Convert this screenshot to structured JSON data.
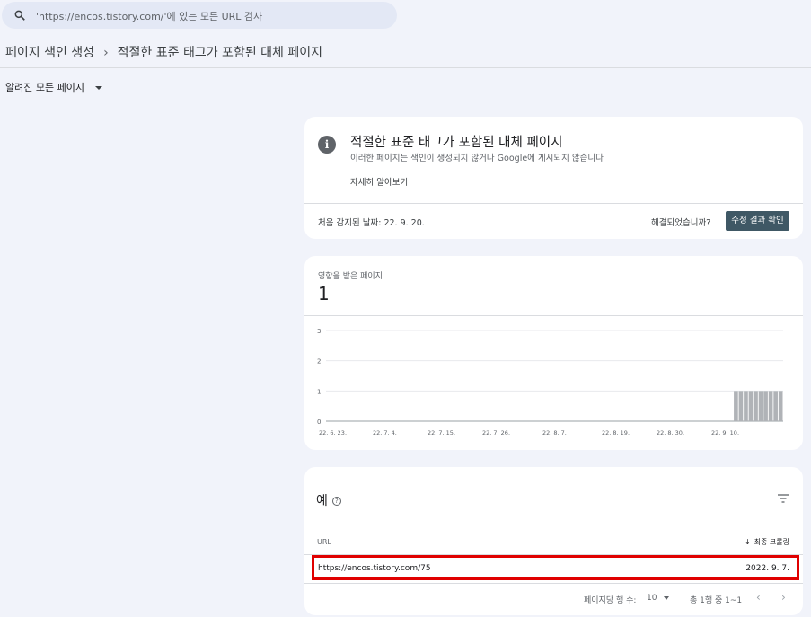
{
  "search": {
    "placeholder": "'https://encos.tistory.com/'에 있는 모든 URL 검사"
  },
  "breadcrumb": {
    "parent": "페이지 색인 생성",
    "current": "적절한 표준 태그가 포함된 대체 페이지"
  },
  "filter": {
    "label": "알려진 모든 페이지"
  },
  "issue": {
    "title": "적절한 표준 태그가 포함된 대체 페이지",
    "description": "이러한 페이지는 색인이 생성되지 않거나 Google에 게시되지 않습니다",
    "learn_more": "자세히 알아보기",
    "first_detected": "처음 감지된 날짜: 22. 9. 20.",
    "resolved_question": "해결되었습니까?",
    "validate_button": "수정 결과 확인"
  },
  "affected": {
    "label": "영향을 받은 페이지",
    "count": "1"
  },
  "chart_data": {
    "type": "bar",
    "ylim": [
      0,
      3
    ],
    "yticks": [
      "0",
      "1",
      "2",
      "3"
    ],
    "xticks": [
      "22. 6. 23.",
      "22. 7. 4.",
      "22. 7. 15.",
      "22. 7. 26.",
      "22. 8. 7.",
      "22. 8. 19.",
      "22. 8. 30.",
      "22. 9. 10."
    ],
    "bar_color": "#b0b3b7",
    "values": [
      0,
      0,
      0,
      0,
      0,
      0,
      0,
      0,
      0,
      0,
      0,
      0,
      0,
      0,
      0,
      0,
      0,
      0,
      0,
      0,
      0,
      0,
      0,
      0,
      0,
      0,
      0,
      0,
      0,
      0,
      0,
      0,
      0,
      0,
      0,
      0,
      0,
      0,
      0,
      0,
      0,
      0,
      0,
      0,
      0,
      0,
      0,
      0,
      0,
      0,
      0,
      0,
      0,
      0,
      0,
      0,
      0,
      0,
      0,
      0,
      0,
      0,
      0,
      0,
      0,
      0,
      0,
      0,
      0,
      0,
      0,
      0,
      0,
      0,
      0,
      0,
      0,
      0,
      0,
      0,
      0,
      0,
      1,
      1,
      1,
      1,
      1,
      1,
      1,
      1,
      1,
      1
    ]
  },
  "examples": {
    "title": "예",
    "help_icon": "?",
    "col_url": "URL",
    "col_crawl": "최종 크롤링",
    "rows": [
      {
        "url": "https://encos.tistory.com/75",
        "date": "2022. 9. 7."
      }
    ],
    "pager": {
      "rows_label": "페이지당 행 수:",
      "rows_value": "10",
      "range": "총 1행 중 1~1",
      "prev": "‹",
      "next": "›"
    }
  },
  "colors": {
    "accent_button": "#3f5865",
    "highlight_box": "#e00000",
    "background": "#f1f3fa"
  }
}
